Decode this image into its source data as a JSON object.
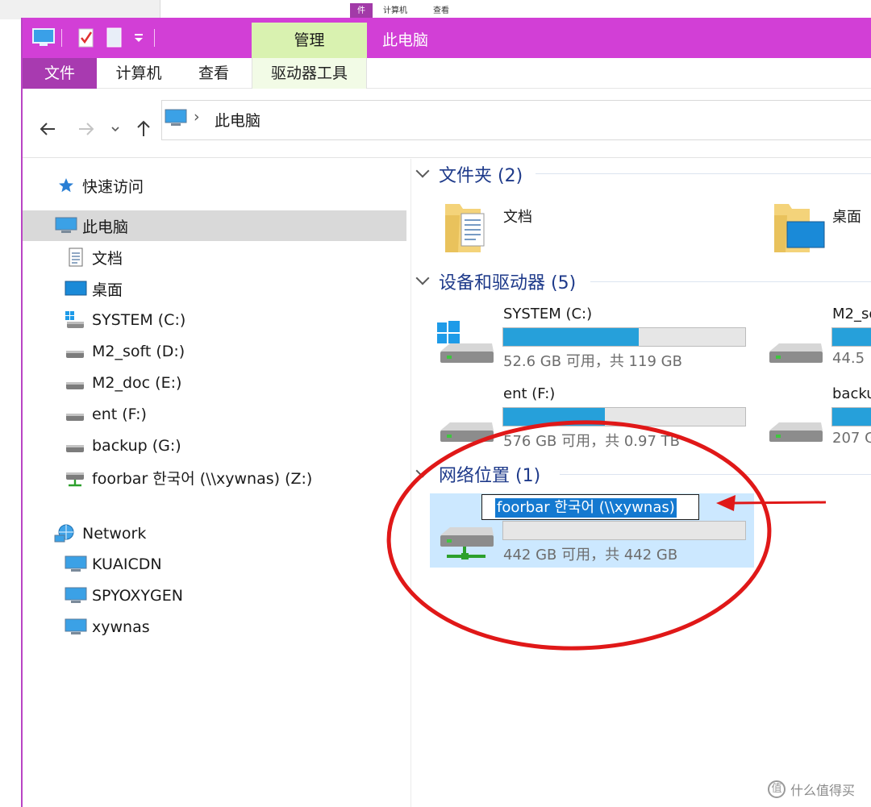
{
  "background_window": {
    "tab_active": "件",
    "tab_computer": "计算机",
    "tab_view": "查看"
  },
  "titlebar": {
    "title": "此电脑",
    "contextual_tab": "管理",
    "accent_color": "#d23fd6"
  },
  "ribbon": {
    "tabs": [
      {
        "label": "文件"
      },
      {
        "label": "计算机"
      },
      {
        "label": "查看"
      },
      {
        "label": "驱动器工具"
      }
    ]
  },
  "address_bar": {
    "separator": "›",
    "location": "此电脑"
  },
  "sidebar": {
    "quick_access": "快速访问",
    "this_pc": "此电脑",
    "items": [
      {
        "label": "文档",
        "icon": "document-icon"
      },
      {
        "label": "桌面",
        "icon": "desktop-icon"
      },
      {
        "label": "SYSTEM (C:)",
        "icon": "windows-drive-icon"
      },
      {
        "label": "M2_soft (D:)",
        "icon": "drive-icon"
      },
      {
        "label": "M2_doc (E:)",
        "icon": "drive-icon"
      },
      {
        "label": "ent (F:)",
        "icon": "drive-icon"
      },
      {
        "label": "backup (G:)",
        "icon": "drive-icon"
      },
      {
        "label": "foorbar 한국어 (\\\\xywnas) (Z:)",
        "icon": "network-drive-icon"
      }
    ],
    "network": "Network",
    "network_items": [
      {
        "label": "KUAICDN"
      },
      {
        "label": "SPYOXYGEN"
      },
      {
        "label": "xywnas"
      }
    ]
  },
  "content": {
    "folders_group": "文件夹 (2)",
    "folders": [
      {
        "name": "文档"
      },
      {
        "name": "桌面"
      }
    ],
    "devices_group": "设备和驱动器 (5)",
    "drives": [
      {
        "name": "SYSTEM (C:)",
        "info": "52.6 GB 可用，共 119 GB",
        "used_fraction": 0.56
      },
      {
        "name": "M2_so",
        "info": "44.5",
        "used_fraction": 1.0
      },
      {
        "name": "ent (F:)",
        "info": "576 GB 可用，共 0.97 TB",
        "used_fraction": 0.42
      },
      {
        "name": "backu",
        "info": "207 G",
        "used_fraction": 1.0
      }
    ],
    "network_group": "网络位置 (1)",
    "network_location": {
      "rename_text": "foorbar 한국어 (\\\\xywnas)",
      "info": "442 GB 可用，共 442 GB",
      "used_fraction": 0.0
    }
  },
  "annotation": {
    "color": "#e01818"
  },
  "watermark": {
    "glyph": "值",
    "text": "什么值得买"
  }
}
